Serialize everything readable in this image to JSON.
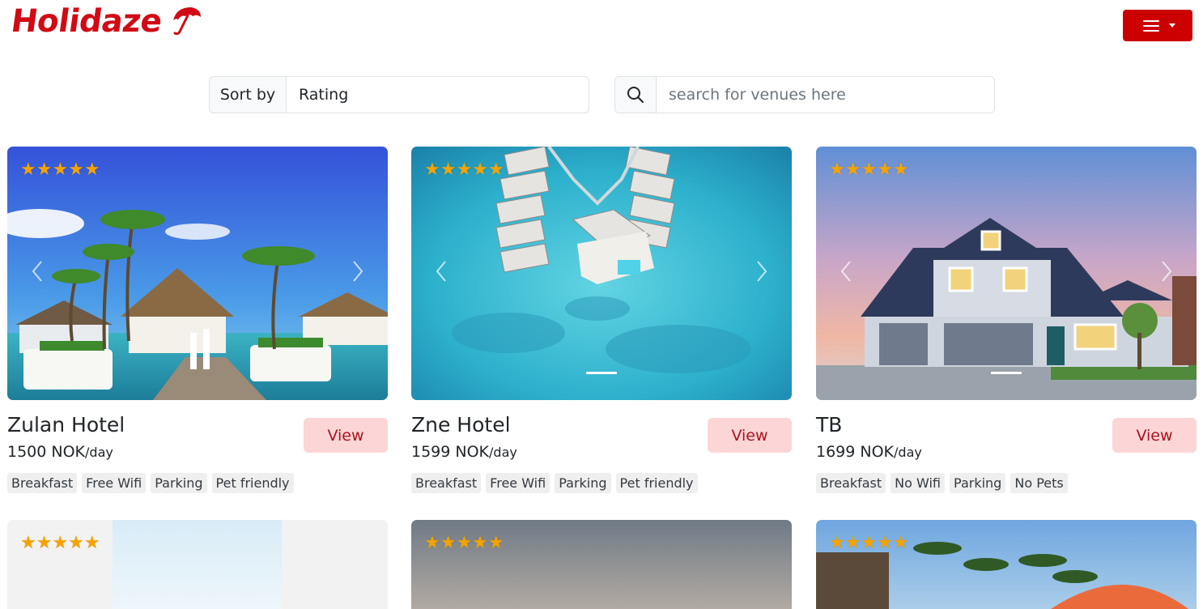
{
  "brand": {
    "name": "Holidaze",
    "logo_icon": "umbrella-icon"
  },
  "nav": {
    "menu_icon": "hamburger-icon"
  },
  "sort": {
    "label": "Sort by",
    "value": "Rating"
  },
  "search": {
    "placeholder": "search for venues here",
    "icon": "search-icon"
  },
  "colors": {
    "brand_red": "#cc0000",
    "view_button_bg": "#fcd5d7",
    "star": "#f5a300"
  },
  "venues": [
    {
      "name": "Zulan Hotel",
      "price": "1500 NOK",
      "unit": "/day",
      "rating": 5,
      "view_label": "View",
      "tags": [
        "Breakfast",
        "Free Wifi",
        "Parking",
        "Pet friendly"
      ]
    },
    {
      "name": "Zne Hotel",
      "price": "1599 NOK",
      "unit": "/day",
      "rating": 5,
      "view_label": "View",
      "tags": [
        "Breakfast",
        "Free Wifi",
        "Parking",
        "Pet friendly"
      ]
    },
    {
      "name": "TB",
      "price": "1699 NOK",
      "unit": "/day",
      "rating": 5,
      "view_label": "View",
      "tags": [
        "Breakfast",
        "No Wifi",
        "Parking",
        "No Pets"
      ]
    }
  ],
  "next_row_ratings": [
    5,
    5,
    5
  ]
}
